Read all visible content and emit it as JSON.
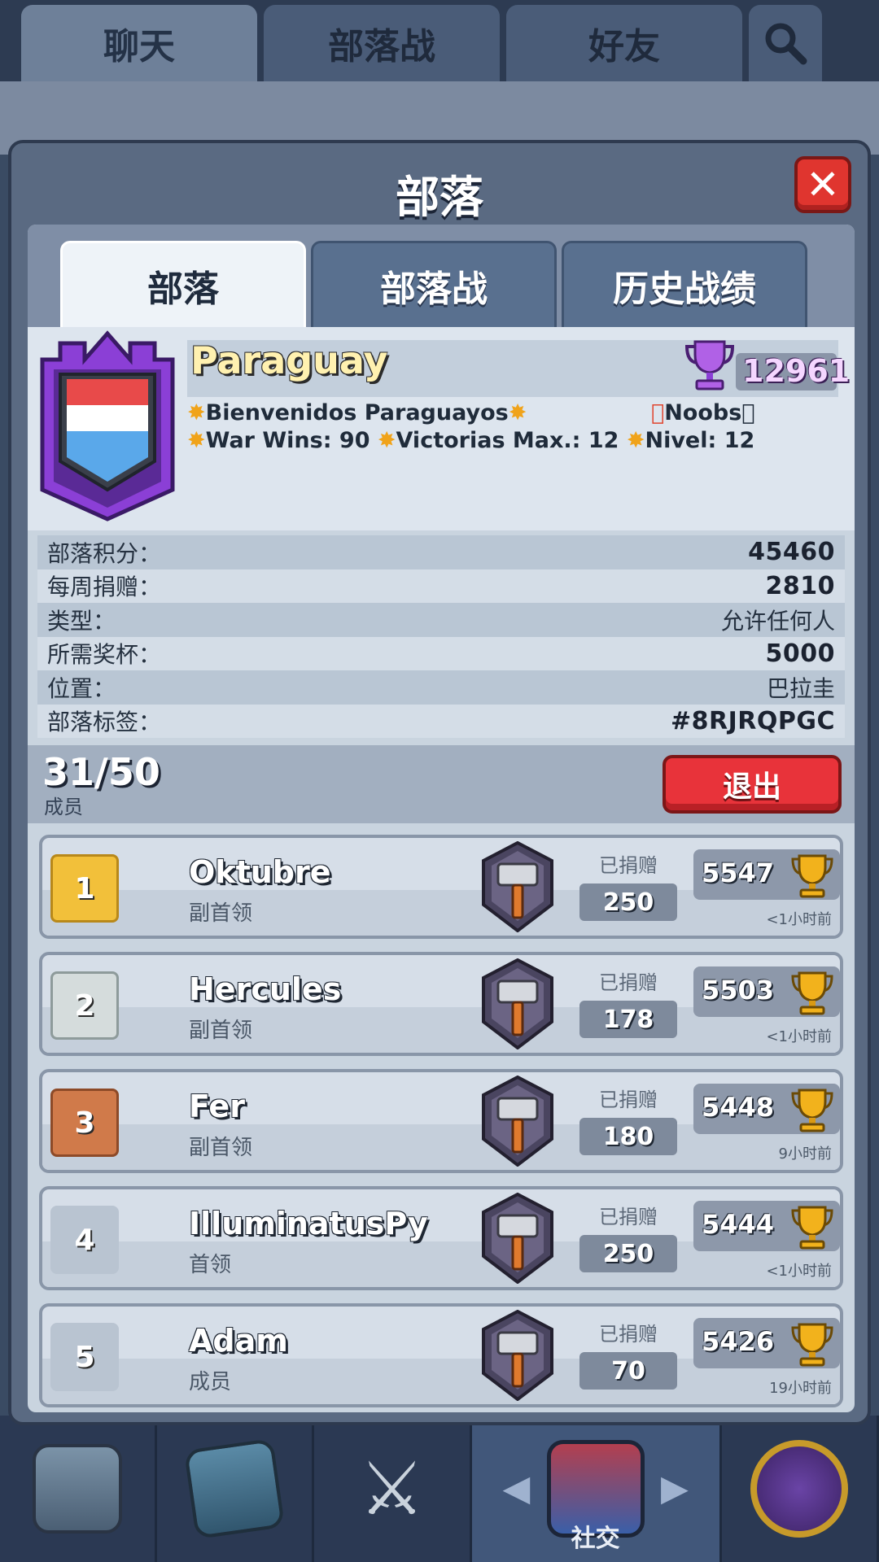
{
  "top_tabs": [
    {
      "label": "聊天"
    },
    {
      "label": "部落战"
    },
    {
      "label": "好友"
    }
  ],
  "modal": {
    "title": "部落",
    "tabs": [
      {
        "label": "部落"
      },
      {
        "label": "部落战"
      },
      {
        "label": "历史战绩"
      }
    ]
  },
  "clan": {
    "name": "Paraguay",
    "trophies": "12961",
    "desc_line1": "Bienvenidos Paraguayos",
    "desc_noobs": "Noobs",
    "desc_war": "War Wins: 90",
    "desc_victorias": "Victorias Max.: 12",
    "desc_nivel": "Nivel: 12",
    "badge_colors": {
      "frame": "#8b3fd6",
      "flag_red": "#e84a4a",
      "flag_white": "#ffffff",
      "flag_blue": "#5aa8ea"
    }
  },
  "stats": [
    {
      "label": "部落积分：",
      "value": "45460"
    },
    {
      "label": "每周捐赠：",
      "value": "2810"
    },
    {
      "label": "类型：",
      "value": "允许任何人"
    },
    {
      "label": "所需奖杯：",
      "value": "5000"
    },
    {
      "label": "位置：",
      "value": "巴拉圭"
    },
    {
      "label": "部落标签：",
      "value": "#8RJRQPGC"
    }
  ],
  "members_header": {
    "count": "31/50",
    "label": "成员",
    "leave_label": "退出"
  },
  "members": [
    {
      "rank": "1",
      "name": "Oktubre",
      "role": "副首领",
      "donated_label": "已捐赠",
      "donated": "250",
      "trophies": "5547",
      "last_seen": "<1小时前"
    },
    {
      "rank": "2",
      "name": "Hercules",
      "role": "副首领",
      "donated_label": "已捐赠",
      "donated": "178",
      "trophies": "5503",
      "last_seen": "<1小时前"
    },
    {
      "rank": "3",
      "name": "Fer",
      "role": "副首领",
      "donated_label": "已捐赠",
      "donated": "180",
      "trophies": "5448",
      "last_seen": "9小时前"
    },
    {
      "rank": "4",
      "name": "IlluminatusPy",
      "role": "首领",
      "donated_label": "已捐赠",
      "donated": "250",
      "trophies": "5444",
      "last_seen": "<1小时前"
    },
    {
      "rank": "5",
      "name": "Adam",
      "role": "成员",
      "donated_label": "已捐赠",
      "donated": "70",
      "trophies": "5426",
      "last_seen": "19小时前"
    }
  ],
  "bottom_nav": {
    "social_label": "社交"
  },
  "icons": {
    "search": "search-icon",
    "close": "close-icon",
    "trophy": "trophy-icon",
    "hammer": "hammer-icon",
    "clan_badge": "clan-badge-icon"
  }
}
